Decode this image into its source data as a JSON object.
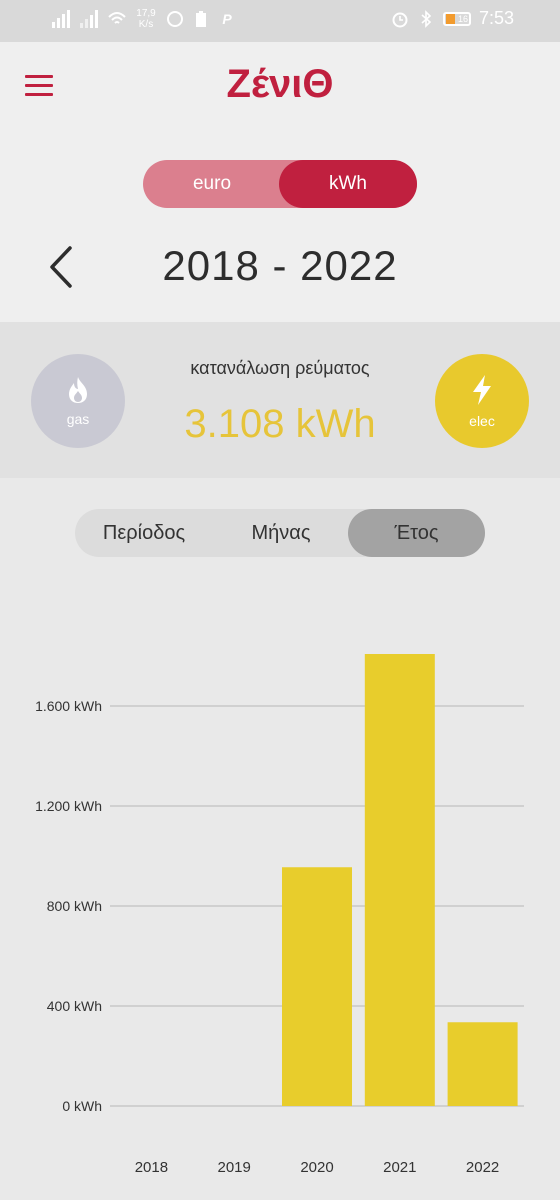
{
  "status_bar": {
    "net_speed": "17,9 K/s",
    "battery_level": "16",
    "time": "7:53"
  },
  "app": {
    "logo_text": "ΖένιΘ",
    "brand_color": "#c0203f"
  },
  "unit_toggle": {
    "options": [
      "euro",
      "kWh"
    ],
    "selected": "kWh"
  },
  "period": {
    "label": "2018 - 2022"
  },
  "summary": {
    "gas_label": "gas",
    "elec_label": "elec",
    "title": "κατανάλωση ρεύματος",
    "value": "3.108 kWh"
  },
  "view_tabs": {
    "options": [
      "Περίοδος",
      "Μήνας",
      "Έτος"
    ],
    "selected": "Έτος"
  },
  "chart_data": {
    "type": "bar",
    "categories": [
      "2018",
      "2019",
      "2020",
      "2021",
      "2022"
    ],
    "values": [
      0,
      0,
      955,
      1808,
      335
    ],
    "ylim": [
      0,
      1800
    ],
    "yticks": [
      0,
      400,
      800,
      1200,
      1600
    ],
    "ytick_labels": [
      "0 kWh",
      "400 kWh",
      "800 kWh",
      "1.200 kWh",
      "1.600 kWh"
    ],
    "grid": true,
    "bar_color": "#e8cd2c"
  }
}
